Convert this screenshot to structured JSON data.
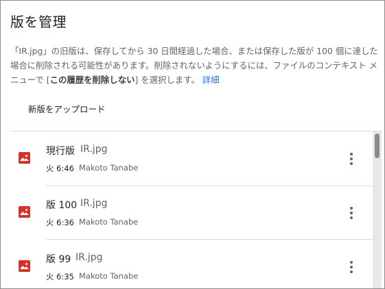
{
  "dialog": {
    "title": "版を管理",
    "description": {
      "part1": "「IR.jpg」の旧版は、保存してから 30 日間経過した場合、または保存した版が 100 個に達した場合に削除される可能性があります。削除されないようにするには、ファイルのコンテキスト メニューで [",
      "emphasis": "この履歴を削除しない",
      "part2": "] を選択します。",
      "link": "詳細"
    },
    "upload_label": "新版をアップロード"
  },
  "versions": [
    {
      "label": "現行版",
      "file": "IR.jpg",
      "time": "火 6:46",
      "user": "Makoto Tanabe"
    },
    {
      "label": "版 100",
      "file": "IR.jpg",
      "time": "火 6:36",
      "user": "Makoto Tanabe"
    },
    {
      "label": "版 99",
      "file": "IR.jpg",
      "time": "火 6:35",
      "user": "Makoto Tanabe"
    }
  ],
  "icons": {
    "file": "image-file-icon",
    "more": "more-vert-icon"
  },
  "colors": {
    "file_icon": "#d93025",
    "link": "#1a73e8"
  }
}
